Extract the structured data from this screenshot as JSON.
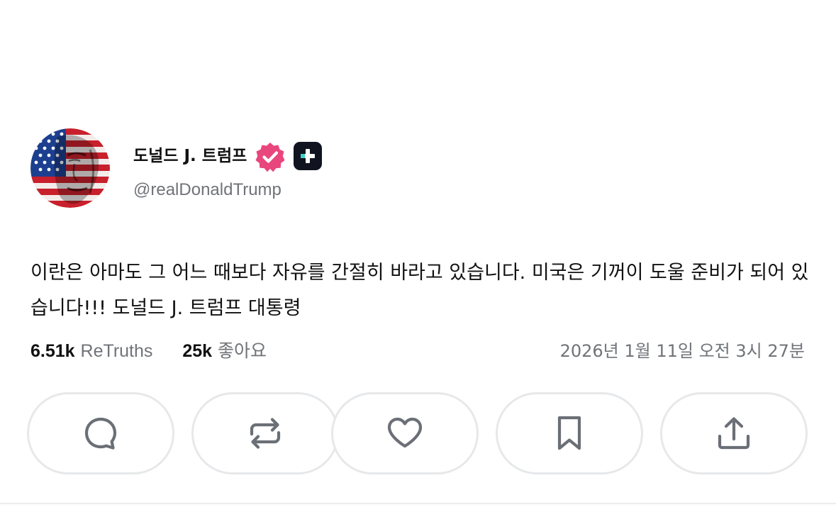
{
  "post": {
    "author": {
      "display_name": "도널드 J. 트럼프",
      "handle": "@realDonaldTrump",
      "avatar_icon": "flag-portrait-avatar",
      "verified_icon": "verified-badge-icon",
      "plus_icon": "plus-badge-icon"
    },
    "text": "이란은 아마도 그 어느 때보다 자유를 간절히 바라고 있습니다. 미국은 기꺼이 도울 준비가 되어 있습니다!!! 도널드 J. 트럼프 대통령",
    "stats": {
      "retruths_count": "6.51k",
      "retruths_label": "ReTruths",
      "likes_count": "25k",
      "likes_label": "좋아요"
    },
    "timestamp": "2026년 1월 11일 오전 3시 27분",
    "actions": [
      {
        "name": "reply",
        "icon": "speech-bubble-icon"
      },
      {
        "name": "retruth",
        "icon": "repost-arrows-icon"
      },
      {
        "name": "like",
        "icon": "heart-icon"
      },
      {
        "name": "bookmark",
        "icon": "bookmark-icon"
      },
      {
        "name": "share",
        "icon": "share-upload-icon"
      }
    ]
  },
  "colors": {
    "text_primary": "#111111",
    "text_secondary": "#707378",
    "verified_badge": "#e8467c",
    "plus_badge": "#101420",
    "plus_badge_accent": "#3fd1c7",
    "button_border": "#e7e8ea",
    "icon_stroke": "#6b6f76"
  }
}
